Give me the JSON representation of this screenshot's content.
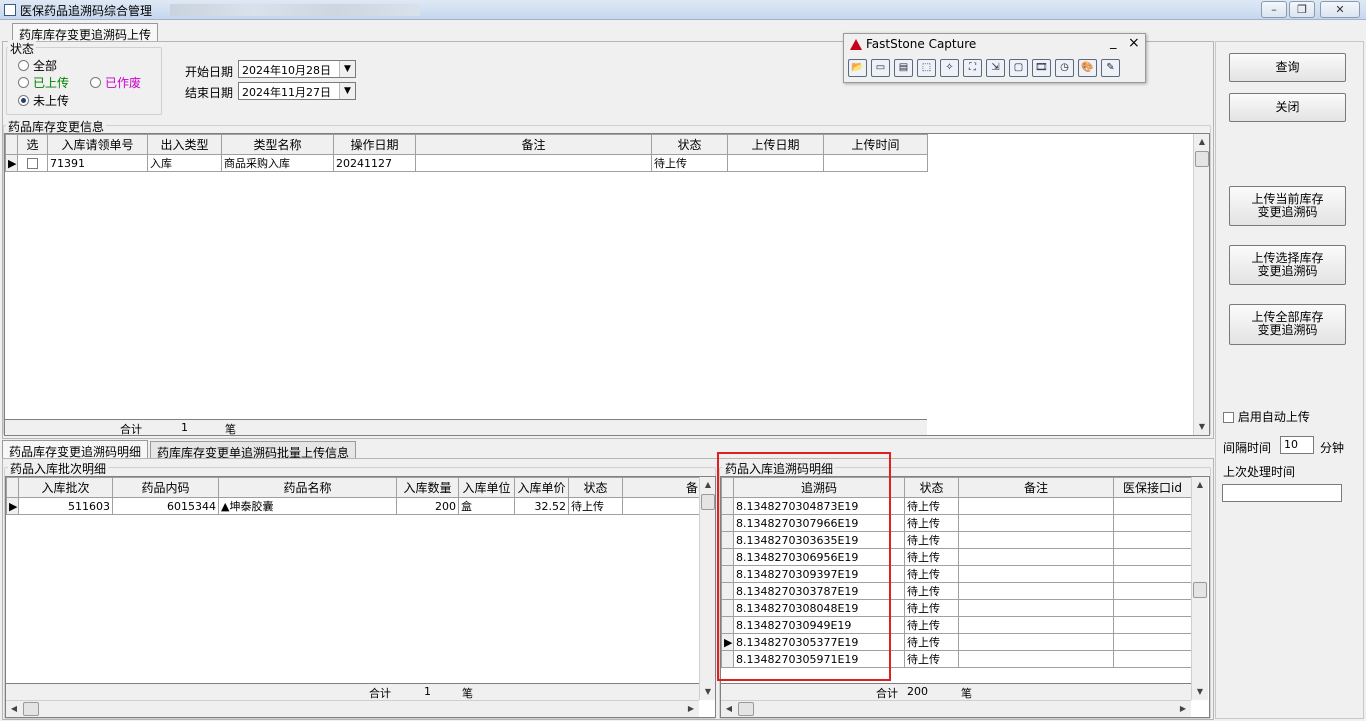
{
  "window": {
    "title": "医保药品追溯码综合管理"
  },
  "top_tab": {
    "label": "药库库存变更追溯码上传"
  },
  "status_group": {
    "label": "状态",
    "options": [
      {
        "label": "全部",
        "checked": false,
        "color": "#000000"
      },
      {
        "label": "已上传",
        "checked": false,
        "color": "#008000"
      },
      {
        "label": "已作废",
        "checked": false,
        "color": "#cc00cc"
      },
      {
        "label": "未上传",
        "checked": true,
        "color": "#000000"
      }
    ]
  },
  "dates": {
    "start_label": "开始日期",
    "start_value": "2024年10月28日",
    "end_label": "结束日期",
    "end_value": "2024年11月27日"
  },
  "faststone": {
    "title": "FastStone Capture",
    "minimize": "_",
    "close": "×",
    "tools": [
      "open-folder-icon",
      "window-icon",
      "scroll-window-icon",
      "rectangle-region-icon",
      "freehand-region-icon",
      "fullscreen-icon",
      "fixed-region-icon",
      "menu-capture-icon",
      "screen-record-icon",
      "timer-icon",
      "output-icon",
      "settings-icon"
    ]
  },
  "side_buttons": {
    "query": "查询",
    "close": "关闭",
    "upload_current_l1": "上传当前库存",
    "upload_current_l2": "变更追溯码",
    "upload_selected_l1": "上传选择库存",
    "upload_selected_l2": "变更追溯码",
    "upload_all_l1": "上传全部库存",
    "upload_all_l2": "变更追溯码"
  },
  "auto_upload": {
    "label": "启用自动上传",
    "interval_label": "间隔时间",
    "interval_value": "10",
    "interval_unit": "分钟",
    "last_time_label": "上次处理时间",
    "last_time_value": ""
  },
  "inventory": {
    "label": "药品库存变更信息",
    "headers": [
      "选",
      "入库请领单号",
      "出入类型",
      "类型名称",
      "操作日期",
      "备注",
      "状态",
      "上传日期",
      "上传时间"
    ],
    "rows": [
      [
        "",
        "71391",
        "入库",
        "商品采购入库",
        "20241127",
        "",
        "待上传",
        "",
        ""
      ]
    ],
    "footer": {
      "total_label": "合计",
      "total_value": "1",
      "unit": "笔"
    }
  },
  "bottom_tabs": [
    "药品库存变更追溯码明细",
    "药库库存变更单追溯码批量上传信息"
  ],
  "batch": {
    "label": "药品入库批次明细",
    "headers": [
      "入库批次",
      "药品内码",
      "药品名称",
      "入库数量",
      "入库单位",
      "入库单价",
      "状态",
      "备"
    ],
    "rows": [
      [
        "511603",
        "6015344",
        "▲坤泰胶囊",
        "200",
        "盒",
        "32.52",
        "待上传",
        ""
      ]
    ],
    "footer": {
      "total_label": "合计",
      "total_value": "1",
      "unit": "笔"
    }
  },
  "trace": {
    "label": "药品入库追溯码明细",
    "headers": [
      "追溯码",
      "状态",
      "备注",
      "医保接口id"
    ],
    "rows": [
      [
        "8.1348270304873E19",
        "待上传",
        "",
        ""
      ],
      [
        "8.1348270307966E19",
        "待上传",
        "",
        ""
      ],
      [
        "8.1348270303635E19",
        "待上传",
        "",
        ""
      ],
      [
        "8.1348270306956E19",
        "待上传",
        "",
        ""
      ],
      [
        "8.1348270309397E19",
        "待上传",
        "",
        ""
      ],
      [
        "8.1348270303787E19",
        "待上传",
        "",
        ""
      ],
      [
        "8.1348270308048E19",
        "待上传",
        "",
        ""
      ],
      [
        "8.134827030949E19",
        "待上传",
        "",
        ""
      ],
      [
        "8.1348270305377E19",
        "待上传",
        "",
        ""
      ],
      [
        "8.1348270305971E19",
        "待上传",
        "",
        ""
      ]
    ],
    "current_row": 8,
    "footer": {
      "total_label": "合计",
      "total_value": "200",
      "unit": "笔"
    }
  }
}
